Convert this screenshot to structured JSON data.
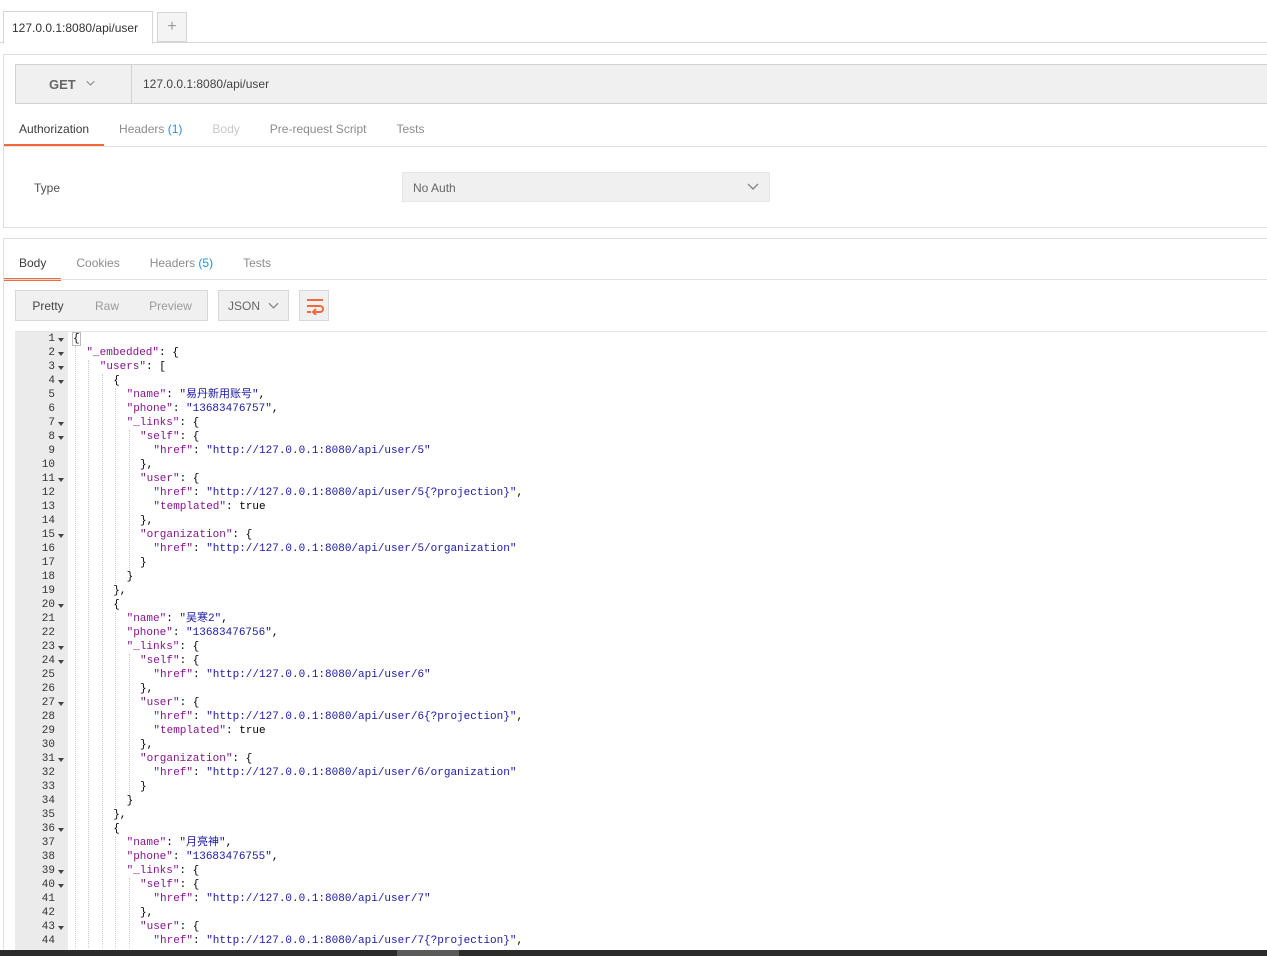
{
  "request_tabs": {
    "active_label": "127.0.0.1:8080/api/user",
    "new_tab_label": "+"
  },
  "request": {
    "method": "GET",
    "url": "127.0.0.1:8080/api/user",
    "tabs": [
      {
        "label": "Authorization",
        "count": ""
      },
      {
        "label": "Headers",
        "count": "(1)"
      },
      {
        "label": "Body",
        "count": ""
      },
      {
        "label": "Pre-request Script",
        "count": ""
      },
      {
        "label": "Tests",
        "count": ""
      }
    ],
    "auth": {
      "type_label": "Type",
      "type_value": "No Auth"
    }
  },
  "response": {
    "tabs": [
      {
        "label": "Body",
        "count": ""
      },
      {
        "label": "Cookies",
        "count": ""
      },
      {
        "label": "Headers",
        "count": "(5)"
      },
      {
        "label": "Tests",
        "count": ""
      }
    ],
    "views": [
      "Pretty",
      "Raw",
      "Preview"
    ],
    "format": "JSON",
    "code_lines": [
      {
        "n": "1",
        "fold": true,
        "indent": 0,
        "t": [
          [
            "b",
            "{"
          ]
        ]
      },
      {
        "n": "2",
        "fold": true,
        "indent": 1,
        "t": [
          [
            "k",
            "\"_embedded\""
          ],
          [
            "p",
            ": {"
          ]
        ]
      },
      {
        "n": "3",
        "fold": true,
        "indent": 2,
        "t": [
          [
            "k",
            "\"users\""
          ],
          [
            "p",
            ": ["
          ]
        ]
      },
      {
        "n": "4",
        "fold": true,
        "indent": 3,
        "t": [
          [
            "p",
            "{"
          ]
        ]
      },
      {
        "n": "5",
        "fold": false,
        "indent": 4,
        "t": [
          [
            "k",
            "\"name\""
          ],
          [
            "p",
            ": "
          ],
          [
            "s",
            "\"易丹新用账号\""
          ],
          [
            "p",
            ","
          ]
        ]
      },
      {
        "n": "6",
        "fold": false,
        "indent": 4,
        "t": [
          [
            "k",
            "\"phone\""
          ],
          [
            "p",
            ": "
          ],
          [
            "s",
            "\"13683476757\""
          ],
          [
            "p",
            ","
          ]
        ]
      },
      {
        "n": "7",
        "fold": true,
        "indent": 4,
        "t": [
          [
            "k",
            "\"_links\""
          ],
          [
            "p",
            ": {"
          ]
        ]
      },
      {
        "n": "8",
        "fold": true,
        "indent": 5,
        "t": [
          [
            "k",
            "\"self\""
          ],
          [
            "p",
            ": {"
          ]
        ]
      },
      {
        "n": "9",
        "fold": false,
        "indent": 6,
        "t": [
          [
            "k",
            "\"href\""
          ],
          [
            "p",
            ": "
          ],
          [
            "s",
            "\"http://127.0.0.1:8080/api/user/5\""
          ]
        ]
      },
      {
        "n": "10",
        "fold": false,
        "indent": 5,
        "t": [
          [
            "p",
            "},"
          ]
        ]
      },
      {
        "n": "11",
        "fold": true,
        "indent": 5,
        "t": [
          [
            "k",
            "\"user\""
          ],
          [
            "p",
            ": {"
          ]
        ]
      },
      {
        "n": "12",
        "fold": false,
        "indent": 6,
        "t": [
          [
            "k",
            "\"href\""
          ],
          [
            "p",
            ": "
          ],
          [
            "s",
            "\"http://127.0.0.1:8080/api/user/5{?projection}\""
          ],
          [
            "p",
            ","
          ]
        ]
      },
      {
        "n": "13",
        "fold": false,
        "indent": 6,
        "t": [
          [
            "k",
            "\"templated\""
          ],
          [
            "p",
            ": true"
          ]
        ]
      },
      {
        "n": "14",
        "fold": false,
        "indent": 5,
        "t": [
          [
            "p",
            "},"
          ]
        ]
      },
      {
        "n": "15",
        "fold": true,
        "indent": 5,
        "t": [
          [
            "k",
            "\"organization\""
          ],
          [
            "p",
            ": {"
          ]
        ]
      },
      {
        "n": "16",
        "fold": false,
        "indent": 6,
        "t": [
          [
            "k",
            "\"href\""
          ],
          [
            "p",
            ": "
          ],
          [
            "s",
            "\"http://127.0.0.1:8080/api/user/5/organization\""
          ]
        ]
      },
      {
        "n": "17",
        "fold": false,
        "indent": 5,
        "t": [
          [
            "p",
            "}"
          ]
        ]
      },
      {
        "n": "18",
        "fold": false,
        "indent": 4,
        "t": [
          [
            "p",
            "}"
          ]
        ]
      },
      {
        "n": "19",
        "fold": false,
        "indent": 3,
        "t": [
          [
            "p",
            "},"
          ]
        ]
      },
      {
        "n": "20",
        "fold": true,
        "indent": 3,
        "t": [
          [
            "p",
            "{"
          ]
        ]
      },
      {
        "n": "21",
        "fold": false,
        "indent": 4,
        "t": [
          [
            "k",
            "\"name\""
          ],
          [
            "p",
            ": "
          ],
          [
            "s",
            "\"吴寒2\""
          ],
          [
            "p",
            ","
          ]
        ]
      },
      {
        "n": "22",
        "fold": false,
        "indent": 4,
        "t": [
          [
            "k",
            "\"phone\""
          ],
          [
            "p",
            ": "
          ],
          [
            "s",
            "\"13683476756\""
          ],
          [
            "p",
            ","
          ]
        ]
      },
      {
        "n": "23",
        "fold": true,
        "indent": 4,
        "t": [
          [
            "k",
            "\"_links\""
          ],
          [
            "p",
            ": {"
          ]
        ]
      },
      {
        "n": "24",
        "fold": true,
        "indent": 5,
        "t": [
          [
            "k",
            "\"self\""
          ],
          [
            "p",
            ": {"
          ]
        ]
      },
      {
        "n": "25",
        "fold": false,
        "indent": 6,
        "t": [
          [
            "k",
            "\"href\""
          ],
          [
            "p",
            ": "
          ],
          [
            "s",
            "\"http://127.0.0.1:8080/api/user/6\""
          ]
        ]
      },
      {
        "n": "26",
        "fold": false,
        "indent": 5,
        "t": [
          [
            "p",
            "},"
          ]
        ]
      },
      {
        "n": "27",
        "fold": true,
        "indent": 5,
        "t": [
          [
            "k",
            "\"user\""
          ],
          [
            "p",
            ": {"
          ]
        ]
      },
      {
        "n": "28",
        "fold": false,
        "indent": 6,
        "t": [
          [
            "k",
            "\"href\""
          ],
          [
            "p",
            ": "
          ],
          [
            "s",
            "\"http://127.0.0.1:8080/api/user/6{?projection}\""
          ],
          [
            "p",
            ","
          ]
        ]
      },
      {
        "n": "29",
        "fold": false,
        "indent": 6,
        "t": [
          [
            "k",
            "\"templated\""
          ],
          [
            "p",
            ": true"
          ]
        ]
      },
      {
        "n": "30",
        "fold": false,
        "indent": 5,
        "t": [
          [
            "p",
            "},"
          ]
        ]
      },
      {
        "n": "31",
        "fold": true,
        "indent": 5,
        "t": [
          [
            "k",
            "\"organization\""
          ],
          [
            "p",
            ": {"
          ]
        ]
      },
      {
        "n": "32",
        "fold": false,
        "indent": 6,
        "t": [
          [
            "k",
            "\"href\""
          ],
          [
            "p",
            ": "
          ],
          [
            "s",
            "\"http://127.0.0.1:8080/api/user/6/organization\""
          ]
        ]
      },
      {
        "n": "33",
        "fold": false,
        "indent": 5,
        "t": [
          [
            "p",
            "}"
          ]
        ]
      },
      {
        "n": "34",
        "fold": false,
        "indent": 4,
        "t": [
          [
            "p",
            "}"
          ]
        ]
      },
      {
        "n": "35",
        "fold": false,
        "indent": 3,
        "t": [
          [
            "p",
            "},"
          ]
        ]
      },
      {
        "n": "36",
        "fold": true,
        "indent": 3,
        "t": [
          [
            "p",
            "{"
          ]
        ]
      },
      {
        "n": "37",
        "fold": false,
        "indent": 4,
        "t": [
          [
            "k",
            "\"name\""
          ],
          [
            "p",
            ": "
          ],
          [
            "s",
            "\"月亮神\""
          ],
          [
            "p",
            ","
          ]
        ]
      },
      {
        "n": "38",
        "fold": false,
        "indent": 4,
        "t": [
          [
            "k",
            "\"phone\""
          ],
          [
            "p",
            ": "
          ],
          [
            "s",
            "\"13683476755\""
          ],
          [
            "p",
            ","
          ]
        ]
      },
      {
        "n": "39",
        "fold": true,
        "indent": 4,
        "t": [
          [
            "k",
            "\"_links\""
          ],
          [
            "p",
            ": {"
          ]
        ]
      },
      {
        "n": "40",
        "fold": true,
        "indent": 5,
        "t": [
          [
            "k",
            "\"self\""
          ],
          [
            "p",
            ": {"
          ]
        ]
      },
      {
        "n": "41",
        "fold": false,
        "indent": 6,
        "t": [
          [
            "k",
            "\"href\""
          ],
          [
            "p",
            ": "
          ],
          [
            "s",
            "\"http://127.0.0.1:8080/api/user/7\""
          ]
        ]
      },
      {
        "n": "42",
        "fold": false,
        "indent": 5,
        "t": [
          [
            "p",
            "},"
          ]
        ]
      },
      {
        "n": "43",
        "fold": true,
        "indent": 5,
        "t": [
          [
            "k",
            "\"user\""
          ],
          [
            "p",
            ": {"
          ]
        ]
      },
      {
        "n": "44",
        "fold": false,
        "indent": 6,
        "t": [
          [
            "k",
            "\"href\""
          ],
          [
            "p",
            ": "
          ],
          [
            "s",
            "\"http://127.0.0.1:8080/api/user/7{?projection}\""
          ],
          [
            "p",
            ","
          ]
        ]
      }
    ]
  },
  "colors": {
    "accent": "#f16a3b",
    "count_blue": "#2a8fd8",
    "json_key": "#881391",
    "json_string": "#1a1aa6"
  },
  "icons": {
    "method_dropdown": "chevron-down-icon",
    "auth_dropdown": "chevron-down-icon",
    "format_dropdown": "chevron-down-icon",
    "wrap": "wrap-lines-icon"
  }
}
